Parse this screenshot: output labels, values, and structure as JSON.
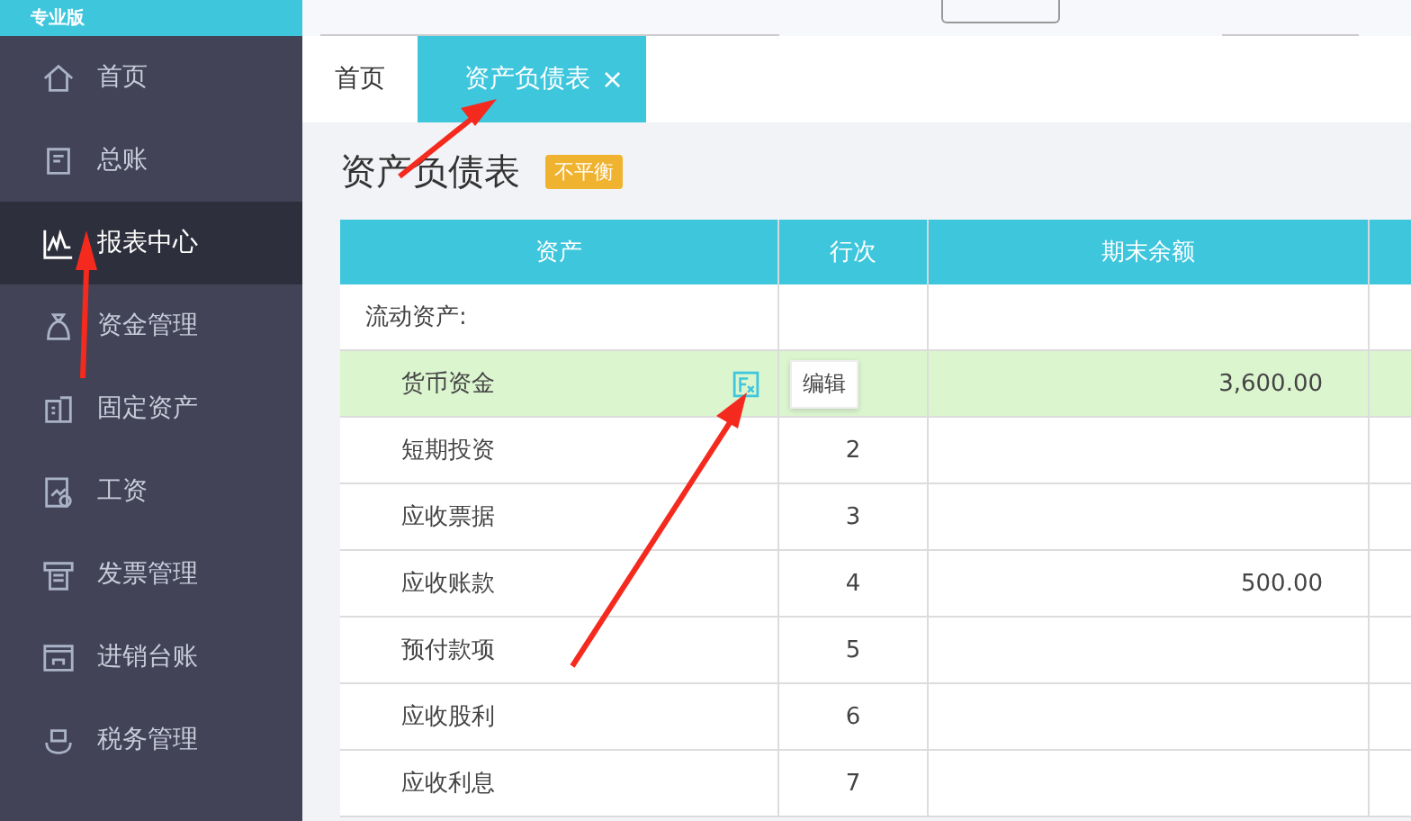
{
  "brand": {
    "edition": "专业版"
  },
  "sidebar": {
    "items": [
      {
        "label": "首页",
        "selected": false
      },
      {
        "label": "总账",
        "selected": false
      },
      {
        "label": "报表中心",
        "selected": true
      },
      {
        "label": "资金管理",
        "selected": false
      },
      {
        "label": "固定资产",
        "selected": false
      },
      {
        "label": "工资",
        "selected": false
      },
      {
        "label": "发票管理",
        "selected": false
      },
      {
        "label": "进销台账",
        "selected": false
      },
      {
        "label": "税务管理",
        "selected": false
      }
    ]
  },
  "tabs": [
    {
      "label": "首页",
      "selected": false
    },
    {
      "label": "资产负债表",
      "selected": true,
      "close": "×"
    }
  ],
  "page": {
    "title": "资产负债表",
    "badge": "不平衡"
  },
  "table": {
    "columns": [
      "资产",
      "行次",
      "期末余额"
    ],
    "rows": [
      {
        "kind": "section",
        "name": "流动资产:",
        "highlighted": false
      },
      {
        "kind": "item",
        "name": "货币资金",
        "amount": "3,600.00",
        "highlighted": true,
        "tooltip": "编辑"
      },
      {
        "kind": "item",
        "name": "短期投资",
        "line": "2",
        "highlighted": false
      },
      {
        "kind": "item",
        "name": "应收票据",
        "line": "3",
        "highlighted": false
      },
      {
        "kind": "item",
        "name": "应收账款",
        "line": "4",
        "amount": "500.00",
        "highlighted": false
      },
      {
        "kind": "item",
        "name": "预付款项",
        "line": "5",
        "highlighted": false
      },
      {
        "kind": "item",
        "name": "应收股利",
        "line": "6",
        "highlighted": false
      },
      {
        "kind": "item",
        "name": "应收利息",
        "line": "7",
        "highlighted": false
      }
    ]
  }
}
